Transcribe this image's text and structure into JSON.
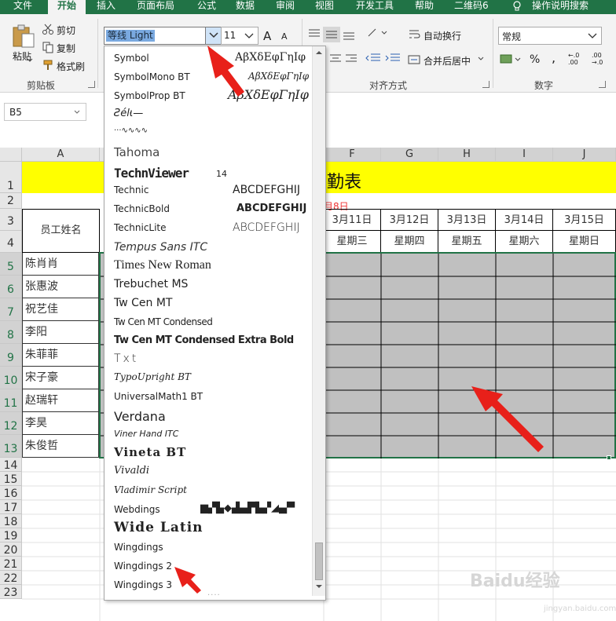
{
  "tabs": [
    "文件",
    "开始",
    "插入",
    "页面布局",
    "公式",
    "数据",
    "审阅",
    "视图",
    "开发工具",
    "帮助",
    "二维码6",
    "操作说明搜索"
  ],
  "clipboard": {
    "paste": "粘贴",
    "cut": "剪切",
    "copy": "复制",
    "format_painter": "格式刷",
    "group": "剪贴板"
  },
  "font": {
    "current": "等线 Light",
    "size": "11",
    "grow": "A",
    "shrink": "A"
  },
  "alignment": {
    "wrap": "自动换行",
    "merge": "合并后居中",
    "group": "对齐方式"
  },
  "number": {
    "format": "常规",
    "percent": "%",
    "comma": ",",
    "inc_decimal": "←.0 .00",
    "dec_decimal": ".00 →.0",
    "group": "数字"
  },
  "name_box": "B5",
  "columns": [
    "A",
    "F",
    "G",
    "H",
    "I",
    "J"
  ],
  "rows": [
    "1",
    "2",
    "3",
    "4",
    "5",
    "6",
    "7",
    "8",
    "9",
    "10",
    "11",
    "12",
    "13",
    "14",
    "15",
    "16",
    "17",
    "18",
    "19",
    "20",
    "21",
    "22",
    "23"
  ],
  "sheet": {
    "title": "勤表",
    "subtitle": "月8日",
    "name_header": "员工姓名",
    "dates": [
      "3月11日",
      "3月12日",
      "3月13日",
      "3月14日",
      "3月15日"
    ],
    "weekdays": [
      "星期三",
      "星期四",
      "星期五",
      "星期六",
      "星期日"
    ],
    "names": [
      "陈肖肖",
      "张惠波",
      "祝艺佳",
      "李阳",
      "朱菲菲",
      "宋子豪",
      "赵瑞轩",
      "李昊",
      "朱俊哲"
    ]
  },
  "font_list": [
    {
      "name": "Symbol",
      "sample": "ΑβΧδΕφΓηΙφ"
    },
    {
      "name": "SymbolMono BT",
      "sample": "ΑβΧδΕφΓηΙφ"
    },
    {
      "name": "SymbolProp BT",
      "sample": "ΑβΧδΕφΓηΙφ"
    },
    {
      "name": "Ƨéŀι—",
      "sample": ""
    },
    {
      "name": "···∿∿∿∿",
      "sample": ""
    },
    {
      "name": "Tahoma",
      "sample": ""
    },
    {
      "name": "TechnViewer",
      "sample": "14"
    },
    {
      "name": "Technic",
      "sample": "ABCDEFGHIJ"
    },
    {
      "name": "TechnicBold",
      "sample": "ABCDEFGHIJ"
    },
    {
      "name": "TechnicLite",
      "sample": "ABCDEFGHIJ"
    },
    {
      "name": "Tempus Sans ITC",
      "sample": ""
    },
    {
      "name": "Times New Roman",
      "sample": ""
    },
    {
      "name": "Trebuchet MS",
      "sample": ""
    },
    {
      "name": "Tw Cen MT",
      "sample": ""
    },
    {
      "name": "Tw Cen MT Condensed",
      "sample": ""
    },
    {
      "name": "Tw Cen MT Condensed Extra Bold",
      "sample": ""
    },
    {
      "name": "Txt",
      "sample": ""
    },
    {
      "name": "TypoUpright BT",
      "sample": ""
    },
    {
      "name": "UniversalMath1 BT",
      "sample": ""
    },
    {
      "name": "Verdana",
      "sample": ""
    },
    {
      "name": "Viner Hand ITC",
      "sample": ""
    },
    {
      "name": "Vineta BT",
      "sample": ""
    },
    {
      "name": "Vivaldi",
      "sample": ""
    },
    {
      "name": "Vladimir Script",
      "sample": ""
    },
    {
      "name": "Webdings",
      "sample": "▆▞▙◆▟▄▛▙▞◢▄▀"
    },
    {
      "name": "Wide Latin",
      "sample": ""
    },
    {
      "name": "Wingdings",
      "sample": ""
    },
    {
      "name": "Wingdings 2",
      "sample": ""
    },
    {
      "name": "Wingdings 3",
      "sample": ""
    }
  ],
  "watermark": {
    "main": "Baidu经验",
    "sub": "jingyan.baidu.com"
  },
  "colors": {
    "excel_green": "#217346",
    "yellow": "#ffff00",
    "grey_fill": "#c0c0c0",
    "arrow_red": "#e8201a",
    "subtitle_red": "#e33333"
  }
}
